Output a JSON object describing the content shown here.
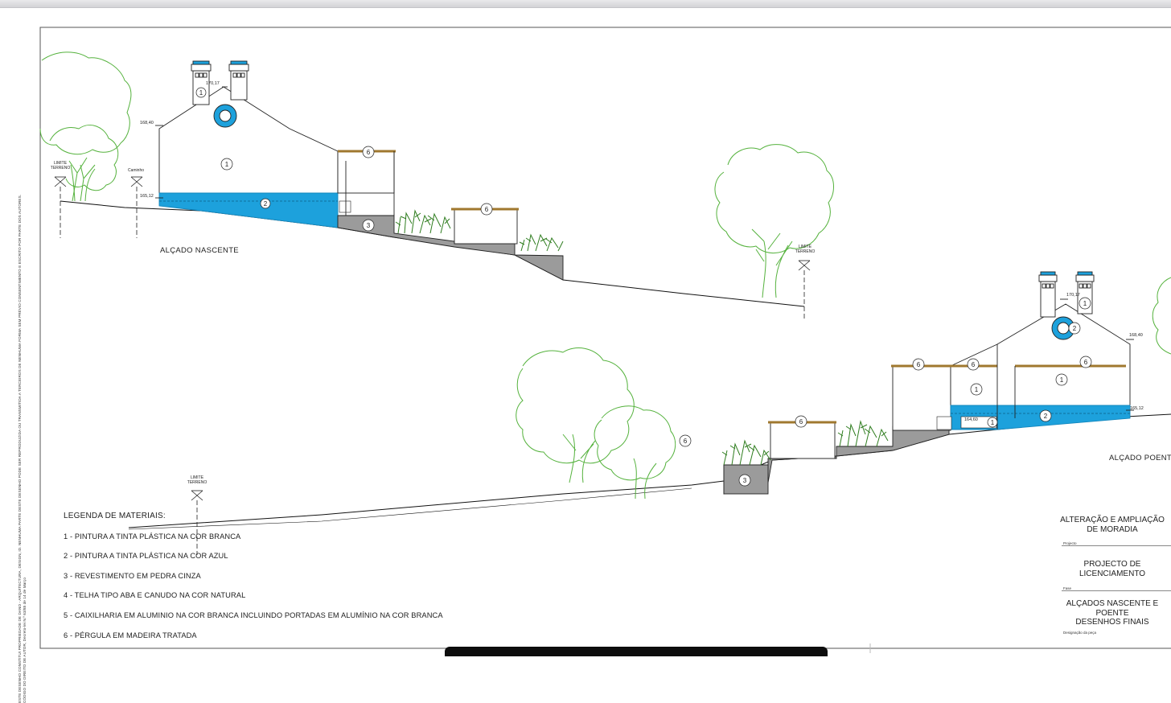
{
  "side_note": {
    "line1": "ESTE DESENHO CONSTITUI PROPRIEDADE DE DANO - ARQUITECTURA, DESIGN, ID. NENHUMA PARTE DESTE DESENHO PODE SER REPRODUZIDA OU TRANSMITIDA A TERCEIROS DE NENHUMA FORMA SEM PRÉVIO CONSENTIMENTO E ESCRITO POR PARTE DOS AUTORES.",
    "line2": "CÓDIGO DO DIREITO DE AUTOR, Decreto-lei N.º 63/85 de 14 de Março"
  },
  "east_elevation": {
    "title": "ALÇADO NASCENTE",
    "limit_label": [
      "LIMITE",
      "TERRENO"
    ],
    "path_label": "Caminho",
    "elev_top": "170,17",
    "elev_eave": "168,40",
    "elev_floor": "165,12",
    "tags": [
      "1",
      "2",
      "1",
      "2",
      "3",
      "6",
      "6"
    ]
  },
  "west_elevation": {
    "title": "ALÇADO POENTE",
    "limit_label": [
      "LIMITE",
      "TERRENO"
    ],
    "elev_top": "170,17",
    "elev_eave": "168,40",
    "elev_floor": "165,12",
    "elev_step": "164,60",
    "tags": [
      "1",
      "2",
      "6",
      "6",
      "6",
      "1",
      "1",
      "1",
      "2",
      "6",
      "3",
      "6"
    ]
  },
  "legend": {
    "title": "LEGENDA DE MATERIAIS:",
    "items": [
      "1 - PINTURA A TINTA PLÁSTICA NA COR BRANCA",
      "2 - PINTURA A TINTA PLÁSTICA NA COR AZUL",
      "3 - REVESTIMENTO EM PEDRA CINZA",
      "4 - TELHA TIPO ABA E CANUDO NA COR NATURAL",
      "5 - CAIXILHARIA EM ALUMINIO NA COR BRANCA INCLUINDO PORTADAS EM ALUMÍNIO NA COR BRANCA",
      "6 - PÉRGULA EM MADEIRA TRATADA"
    ]
  },
  "title_block": {
    "project_line1": "ALTERAÇÃO E AMPLIAÇÃO",
    "project_line2": "DE MORADIA",
    "project_caption": "Projecto",
    "phase_line1": "PROJECTO DE",
    "phase_line2": "LICENCIAMENTO",
    "phase_caption": "Fase",
    "piece_line1": "ALÇADOS NASCENTE E",
    "piece_line2": "POENTE",
    "piece_line3": "DESENHOS FINAIS",
    "piece_caption": "Designação da peça"
  },
  "colors": {
    "blue": "#1da1dc",
    "stone": "#9b9b9b",
    "tree": "#55b23d",
    "timber": "#a0782f"
  }
}
